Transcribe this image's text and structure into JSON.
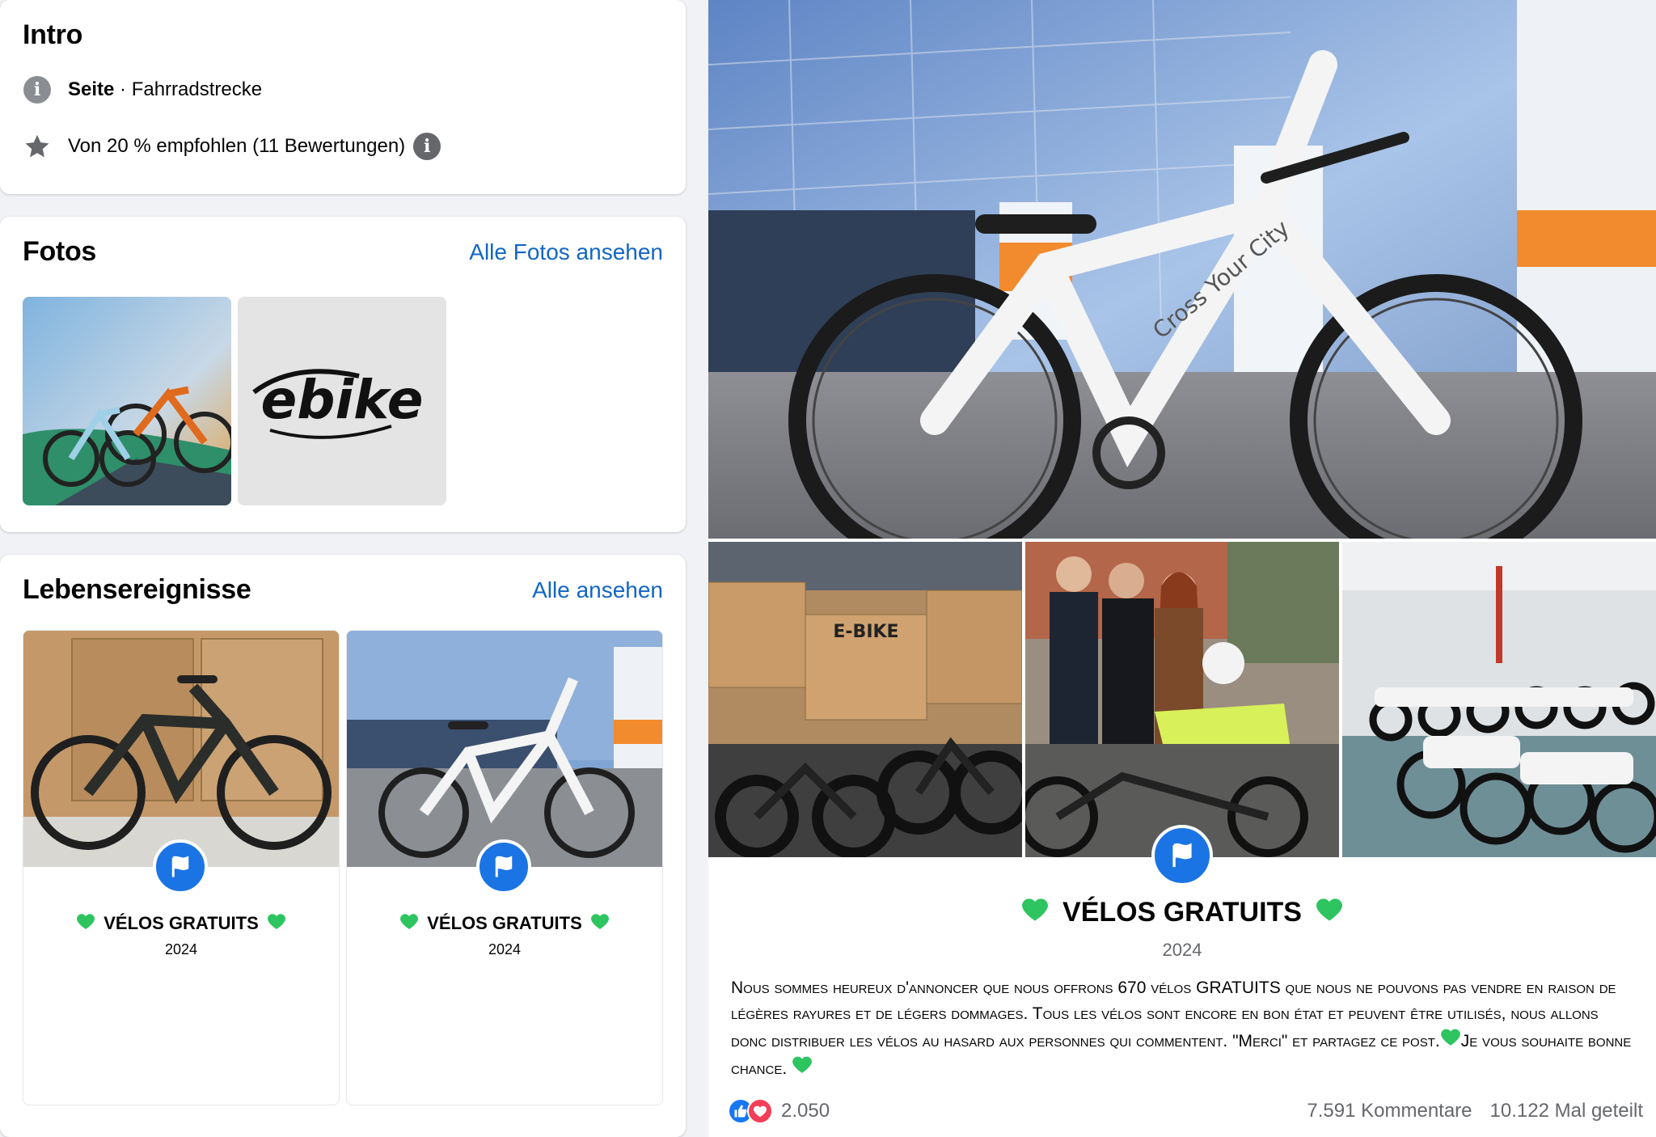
{
  "intro": {
    "title": "Intro",
    "page_type_bold": "Seite",
    "page_type_rest": " · Fahrradstrecke",
    "rating": "Von 20 % empfohlen (11 Bewertungen)"
  },
  "photos": {
    "title": "Fotos",
    "see_all": "Alle Fotos ansehen",
    "logo_text": "ebike"
  },
  "life_events": {
    "title": "Lebensereignisse",
    "see_all": "Alle ansehen",
    "items": [
      {
        "title": "VÉLOS GRATUITS",
        "year": "2024"
      },
      {
        "title": "VÉLOS GRATUITS",
        "year": "2024"
      }
    ]
  },
  "post": {
    "title": "VÉLOS GRATUITS",
    "year": "2024",
    "body": "Nous sommes heureux d'annoncer que nous offrons 670 vélos GRATUITS que nous ne pouvons pas vendre en raison de légères rayures et de légers dommages. Tous les vélos sont encore en bon état et peuvent être utilisés, nous allons donc distribuer les vélos au hasard aux personnes qui commentent. \"Merci\" et partagez ce post.",
    "body_end": "Je vous souhaite bonne chance.",
    "reactions": "2.050",
    "comments": "7.591 Kommentare",
    "shares": "10.122 Mal geteilt",
    "bike_frame_text": "Cross Your City",
    "box_label": "E-BIKE"
  },
  "icons": {
    "info": "info-icon",
    "star": "star-icon",
    "flag": "flag-icon",
    "heart": "green-heart-icon",
    "like": "like-reaction-icon",
    "love": "love-reaction-icon"
  },
  "colors": {
    "link": "#1266c4",
    "badge_blue": "#1b74e4",
    "heart_green": "#2ec460"
  }
}
